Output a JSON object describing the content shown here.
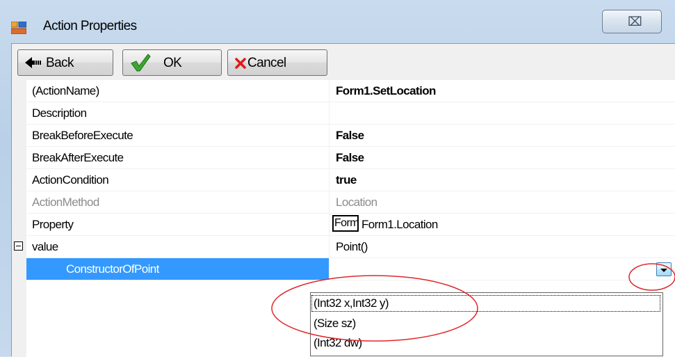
{
  "window": {
    "title": "Action Properties",
    "close_glyph": "⌧"
  },
  "toolbar": {
    "back_label": "Back",
    "ok_label": "OK",
    "cancel_label": "Cancel"
  },
  "grid": {
    "rows": [
      {
        "name": "(ActionName)",
        "value": "Form1.SetLocation"
      },
      {
        "name": "Description",
        "value": ""
      },
      {
        "name": "BreakBeforeExecute",
        "value": "False"
      },
      {
        "name": "BreakAfterExecute",
        "value": "False"
      },
      {
        "name": "ActionCondition",
        "value": "true"
      },
      {
        "name": "ActionMethod",
        "value": "Location"
      },
      {
        "name": "Property",
        "value_icon_text": "Form",
        "value": "Form1.Location"
      },
      {
        "name": "value",
        "value": "Point()"
      },
      {
        "name": "ConstructorOfPoint",
        "value": ""
      }
    ]
  },
  "dropdown": {
    "options": [
      "(Int32 x,Int32 y)",
      "(Size sz)",
      "(Int32 dw)"
    ],
    "selected_index": 0
  },
  "colors": {
    "selection": "#3399ff",
    "annotation": "#e0262a",
    "grid_lines": "#f0f0f0"
  }
}
